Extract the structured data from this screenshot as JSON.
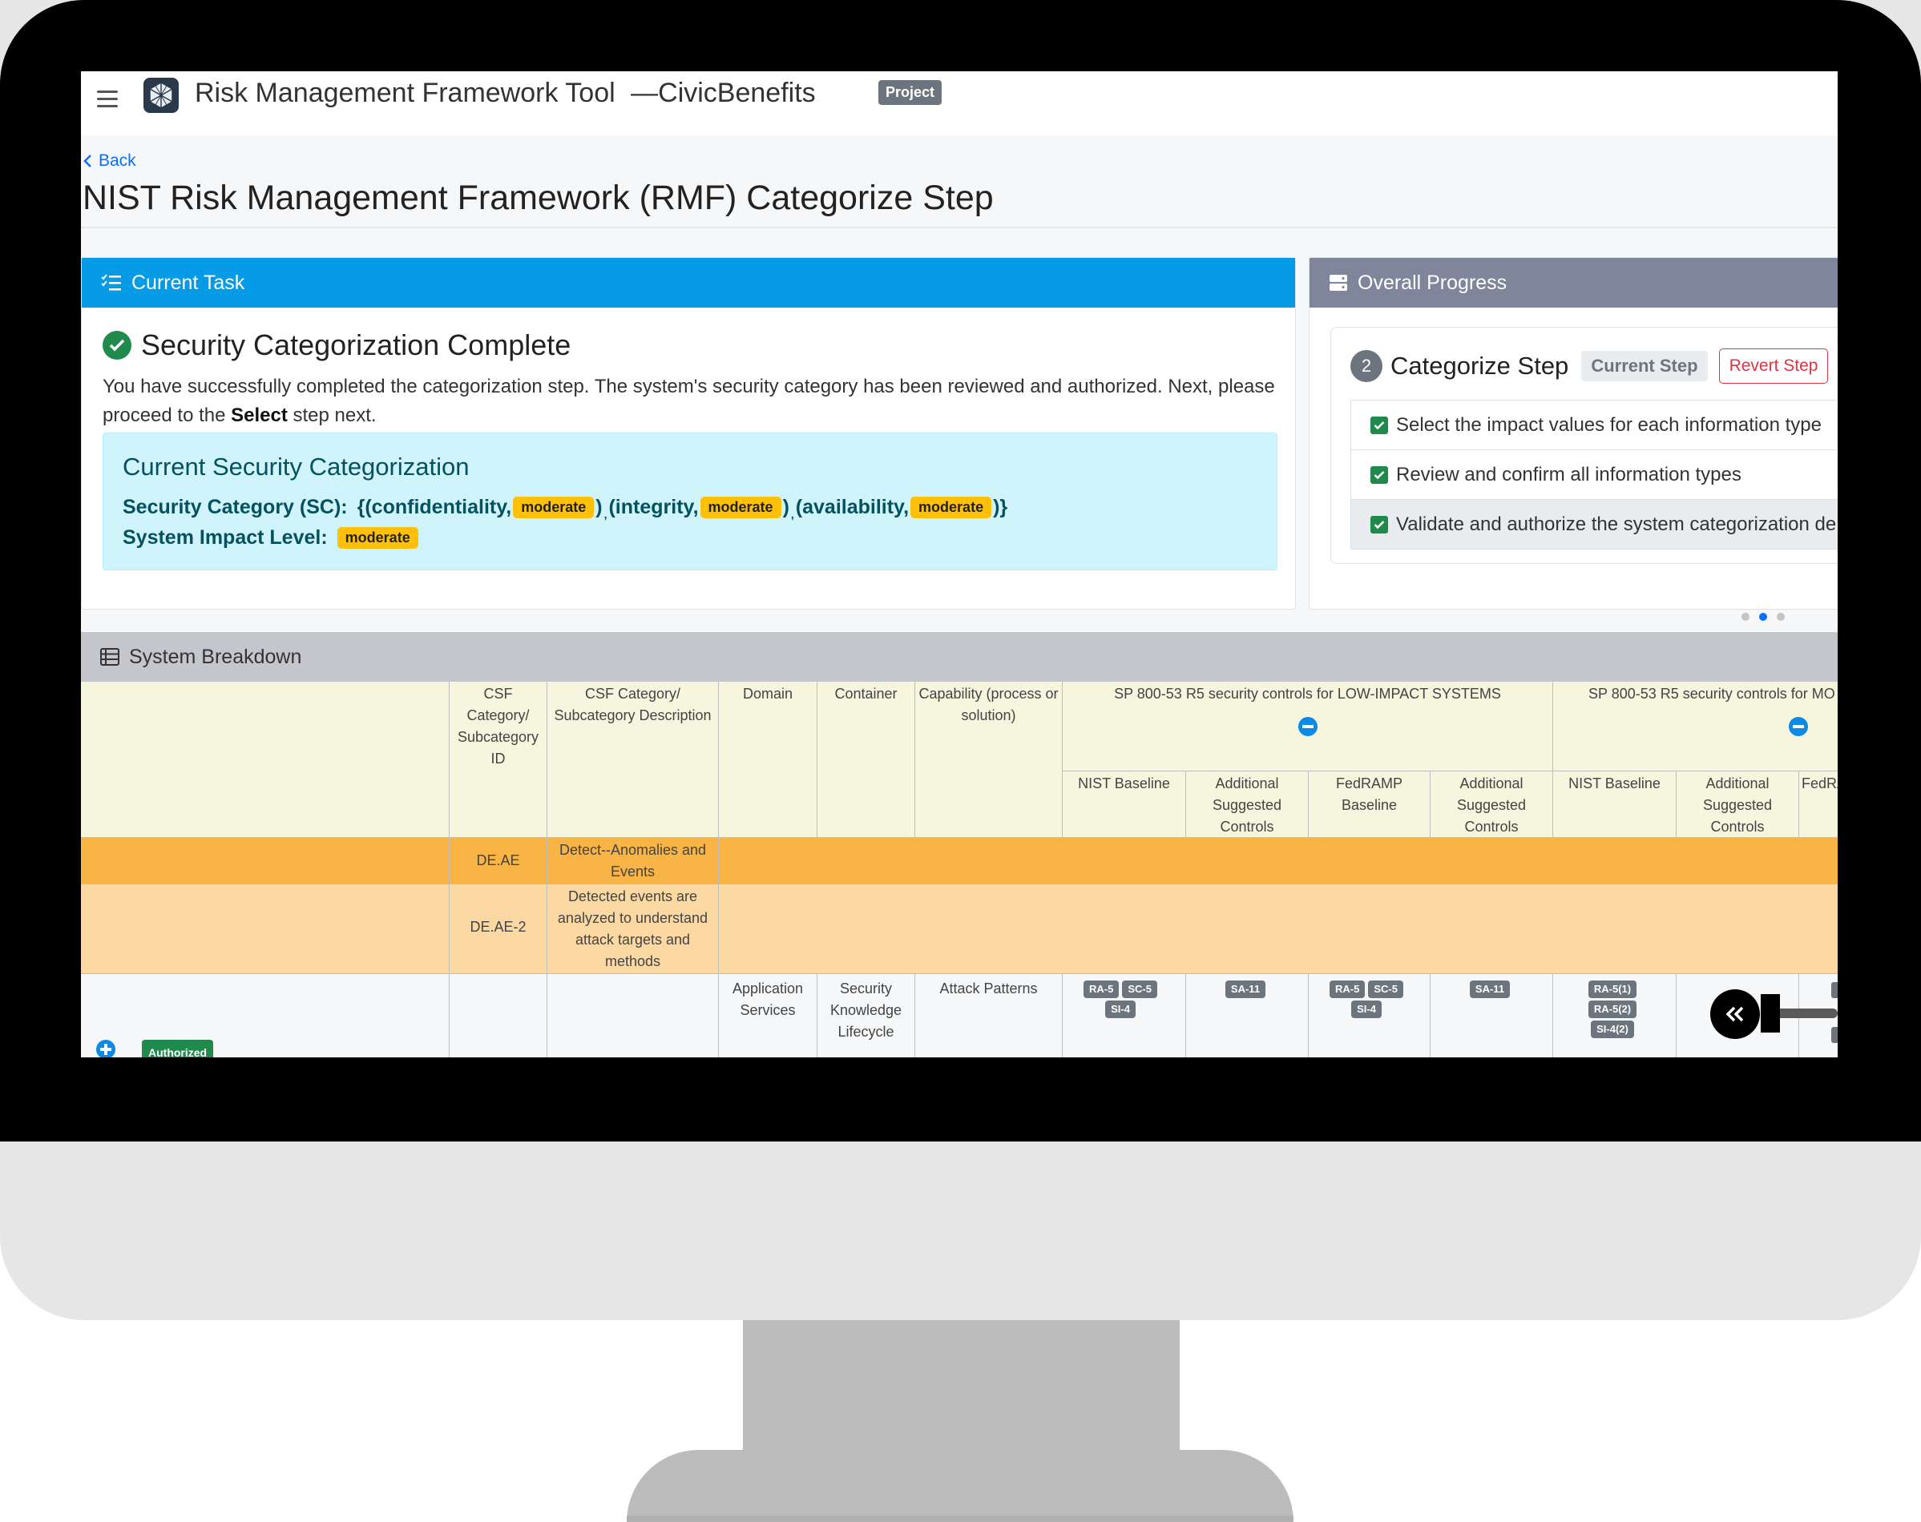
{
  "app": {
    "title": "Risk Management Framework Tool",
    "separator": "—",
    "project_name": "CivicBenefits",
    "project_badge": "Project"
  },
  "nav": {
    "back_label": "Back"
  },
  "page": {
    "title": "NIST Risk Management Framework (RMF) Categorize Step"
  },
  "current_task": {
    "header": "Current Task",
    "complete_title": "Security Categorization Complete",
    "message_before": "You have successfully completed the categorization step. The system's security category has been reviewed and authorized. Next, please proceed to the ",
    "message_bold": "Select",
    "message_after": " step next.",
    "categorization": {
      "title": "Current Security Categorization",
      "sc_label": "Security Category (SC):",
      "open": "{(confidentiality,",
      "confidentiality": "moderate",
      "integrity_label": "(integrity,",
      "integrity": "moderate",
      "availability_label": "(availability,",
      "availability": "moderate",
      "close_paren": ")",
      "close_final": ")}",
      "comma": ",",
      "impact_label": "System Impact Level:",
      "impact": "moderate"
    }
  },
  "overall_progress": {
    "header": "Overall Progress",
    "step_number": "2",
    "step_name": "Categorize Step",
    "current_badge": "Current Step",
    "revert_label": "Revert Step",
    "items": [
      {
        "label": "Select the impact values for each information type",
        "checked": true
      },
      {
        "label": "Review and confirm all information types",
        "checked": true
      },
      {
        "label": "Validate and authorize the system categorization de",
        "checked": true
      }
    ],
    "carousel_active_index": 1
  },
  "system_breakdown": {
    "header": "System Breakdown",
    "columns": {
      "csf_id": "CSF Category/ Subcategory ID",
      "csf_desc": "CSF Category/ Subcategory Description",
      "domain": "Domain",
      "container": "Container",
      "capability": "Capability (process or solution)",
      "low_group": "SP 800-53 R5 security controls for LOW-IMPACT SYSTEMS",
      "mod_group": "SP 800-53 R5 security controls for MO",
      "nist_baseline": "NIST Baseline",
      "additional": "Additional Suggested Controls",
      "fedramp": "FedRAMP Baseline",
      "fedramp_cut": "FedRA"
    },
    "rows": [
      {
        "id": "DE.AE",
        "description": "Detect--Anomalies and Events"
      },
      {
        "id": "DE.AE-2",
        "description": "Detected events are analyzed to understand attack targets and methods"
      }
    ],
    "data_row": {
      "status": "Authorized",
      "domain": "Application Services",
      "container": "Security Knowledge Lifecycle",
      "capability": "Attack Patterns",
      "low_nist": [
        "RA-5",
        "SC-5",
        "SI-4"
      ],
      "low_additional": [
        "SA-11"
      ],
      "low_fedramp": [
        "RA-5",
        "SC-5",
        "SI-4"
      ],
      "low_fedramp_additional": [
        "SA-11"
      ],
      "mod_nist": [
        "RA-5(1)",
        "RA-5(2)",
        "SI-4(2)"
      ]
    }
  },
  "icons": {
    "menu": "hamburger-icon",
    "logo": "cube-logo-icon",
    "back": "chevron-left-icon",
    "task": "list-check-icon",
    "progress": "server-icon",
    "breakdown": "table-list-icon",
    "collapse": "double-chevron-left-icon"
  },
  "colors": {
    "task_header": "#069be7",
    "progress_header": "#7f869b",
    "success": "#1f8a4c",
    "moderate": "#ffc107",
    "info_box": "#cff4fc",
    "category_row": "#f8b444",
    "subcategory_row": "#fcd9a2",
    "header_row": "#f6f5dd"
  }
}
